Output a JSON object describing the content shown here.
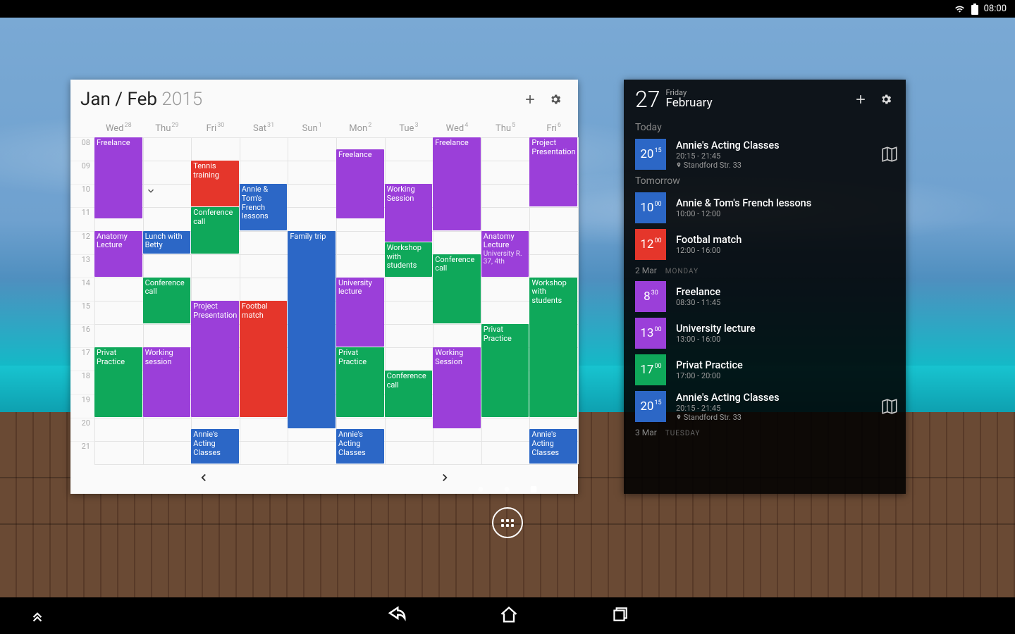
{
  "statusbar": {
    "time": "08:00"
  },
  "week": {
    "title_months": "Jan / Feb",
    "title_year": "2015",
    "days": [
      {
        "label": "Wed",
        "num": "28"
      },
      {
        "label": "Thu",
        "num": "29"
      },
      {
        "label": "Fri",
        "num": "30"
      },
      {
        "label": "Sat",
        "num": "31"
      },
      {
        "label": "Sun",
        "num": "1"
      },
      {
        "label": "Mon",
        "num": "2"
      },
      {
        "label": "Tue",
        "num": "3"
      },
      {
        "label": "Wed",
        "num": "4"
      },
      {
        "label": "Thu",
        "num": "5"
      },
      {
        "label": "Fri",
        "num": "6"
      }
    ],
    "hours": [
      "08",
      "09",
      "10",
      "11",
      "12",
      "13",
      "14",
      "15",
      "16",
      "17",
      "18",
      "19",
      "20",
      "21"
    ],
    "events": [
      {
        "day": 0,
        "start": 8,
        "end": 11.5,
        "color": "purple",
        "title": "Freelance"
      },
      {
        "day": 0,
        "start": 12,
        "end": 14,
        "color": "purple",
        "title": "Anatomy Lecture"
      },
      {
        "day": 0,
        "start": 17,
        "end": 20,
        "color": "green",
        "title": "Privat Practice"
      },
      {
        "day": 1,
        "start": 12,
        "end": 13,
        "color": "blue",
        "title": "Lunch with Betty"
      },
      {
        "day": 1,
        "start": 14,
        "end": 16,
        "color": "green",
        "title": "Conference call"
      },
      {
        "day": 1,
        "start": 17,
        "end": 20,
        "color": "purple",
        "title": "Working session"
      },
      {
        "day": 2,
        "start": 9,
        "end": 11,
        "color": "red",
        "title": "Tennis training"
      },
      {
        "day": 2,
        "start": 11,
        "end": 13,
        "color": "green",
        "title": "Conference call"
      },
      {
        "day": 2,
        "start": 15,
        "end": 20,
        "color": "purple",
        "title": "Project Presentation"
      },
      {
        "day": 2,
        "start": 20.5,
        "end": 22,
        "color": "blue",
        "title": "Annie's Acting Classes"
      },
      {
        "day": 3,
        "start": 10,
        "end": 12,
        "color": "blue",
        "title": "Annie & Tom's French lessons"
      },
      {
        "day": 3,
        "start": 15,
        "end": 20,
        "color": "red",
        "title": "Footbal match"
      },
      {
        "day": 4,
        "start": 12,
        "end": 20.5,
        "color": "blue",
        "title": "Family trip"
      },
      {
        "day": 5,
        "start": 8.5,
        "end": 11.5,
        "color": "purple",
        "title": "Freelance"
      },
      {
        "day": 5,
        "start": 14,
        "end": 17,
        "color": "purple",
        "title": "University lecture"
      },
      {
        "day": 5,
        "start": 17,
        "end": 20,
        "color": "green",
        "title": "Privat Practice"
      },
      {
        "day": 5,
        "start": 20.5,
        "end": 22,
        "color": "blue",
        "title": "Annie's Acting Classes"
      },
      {
        "day": 6,
        "start": 10,
        "end": 12.5,
        "color": "purple",
        "title": "Working Session"
      },
      {
        "day": 6,
        "start": 12.5,
        "end": 14,
        "color": "green",
        "title": "Workshop with students"
      },
      {
        "day": 6,
        "start": 18,
        "end": 20,
        "color": "green",
        "title": "Conference call"
      },
      {
        "day": 7,
        "start": 8,
        "end": 12,
        "color": "purple",
        "title": "Freelance"
      },
      {
        "day": 7,
        "start": 13,
        "end": 16,
        "color": "green",
        "title": "Conference call"
      },
      {
        "day": 7,
        "start": 17,
        "end": 20.5,
        "color": "purple",
        "title": "Working Session"
      },
      {
        "day": 8,
        "start": 12,
        "end": 14,
        "color": "purple",
        "title": "Anatomy Lecture",
        "loc": "University R. 37, 4th"
      },
      {
        "day": 8,
        "start": 16,
        "end": 20,
        "color": "green",
        "title": "Privat Practice"
      },
      {
        "day": 9,
        "start": 8,
        "end": 11,
        "color": "purple",
        "title": "Project Presentation"
      },
      {
        "day": 9,
        "start": 14,
        "end": 20,
        "color": "green",
        "title": "Workshop with students"
      },
      {
        "day": 9,
        "start": 20.5,
        "end": 22,
        "color": "blue",
        "title": "Annie's Acting Classes"
      }
    ]
  },
  "agenda": {
    "header": {
      "day": "27",
      "dow": "Friday",
      "month": "February"
    },
    "sections": [
      {
        "heading": "Today",
        "items": [
          {
            "hour": "20",
            "min": "15",
            "color": "blue",
            "title": "Annie's Acting Classes",
            "sub": "20:15 - 21:45",
            "loc": "Standford Str. 33",
            "map": true
          }
        ]
      },
      {
        "heading": "Tomorrow",
        "items": [
          {
            "hour": "10",
            "min": "00",
            "color": "blue",
            "title": "Annie & Tom's French lessons",
            "sub": "10:00 - 12:00"
          },
          {
            "hour": "12",
            "min": "00",
            "color": "red",
            "title": "Footbal match",
            "sub": "12:00 - 16:00"
          }
        ]
      },
      {
        "heading": "2 Mar",
        "sub": "MONDAY",
        "items": [
          {
            "hour": "8",
            "min": "30",
            "color": "purple",
            "title": "Freelance",
            "sub": "08:30 - 11:45"
          },
          {
            "hour": "13",
            "min": "00",
            "color": "purple",
            "title": "University lecture",
            "sub": "13:00 - 16:00"
          },
          {
            "hour": "17",
            "min": "00",
            "color": "green",
            "title": "Privat Practice",
            "sub": "17:00 - 20:00"
          },
          {
            "hour": "20",
            "min": "15",
            "color": "blue",
            "title": "Annie's Acting Classes",
            "sub": "20:15 - 21:45",
            "loc": "Standford Str. 33",
            "map": true
          }
        ]
      },
      {
        "heading": "3 Mar",
        "sub": "TUESDAY",
        "items": []
      }
    ]
  },
  "colors": {
    "purple": "#9b3fd9",
    "green": "#0fa85a",
    "blue": "#2c67c6",
    "red": "#e5362b"
  }
}
